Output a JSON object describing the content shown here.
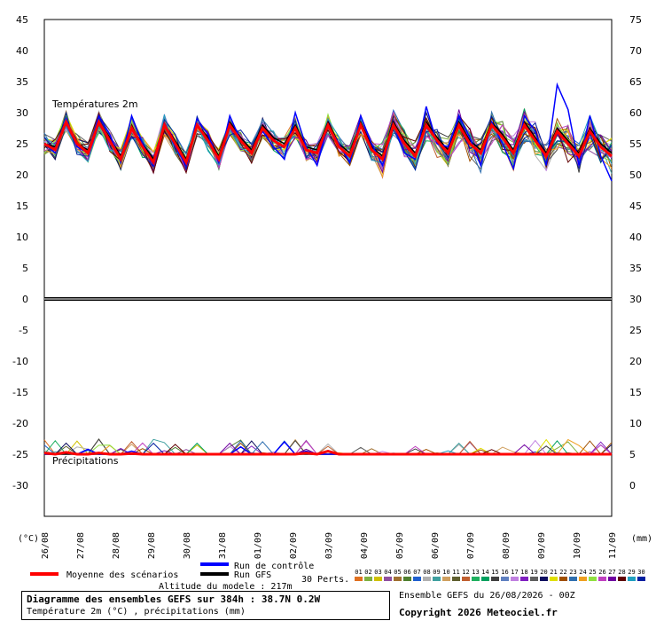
{
  "chart_data": {
    "type": "line",
    "panels": [
      {
        "title": "Températures 2m",
        "ylabel_left": "(°C)",
        "ylim_left": [
          0,
          45
        ],
        "ylim_right": [
          30,
          75
        ]
      },
      {
        "title": "Précipitations",
        "ylabel_right": "(mm)",
        "ylim_left": [
          -35,
          0
        ],
        "ylim_right": [
          -5,
          30
        ]
      }
    ],
    "left_ticks": [
      "45",
      "40",
      "35",
      "30",
      "25",
      "20",
      "15",
      "10",
      "5",
      "0",
      "-5",
      "-10",
      "-15",
      "-20",
      "-25",
      "-30"
    ],
    "right_ticks": [
      "75",
      "70",
      "65",
      "60",
      "55",
      "50",
      "45",
      "40",
      "35",
      "30",
      "25",
      "20",
      "15",
      "10",
      "5",
      "0"
    ],
    "x_labels": [
      "26/08",
      "27/08",
      "28/08",
      "29/08",
      "30/08",
      "31/08",
      "01/09",
      "02/09",
      "03/09",
      "04/09",
      "05/09",
      "06/09",
      "07/09",
      "08/09",
      "09/09",
      "10/09",
      "11/09"
    ],
    "x_unit_left": "(°C)",
    "x_unit_right": "(mm)",
    "series": [
      {
        "name": "Moyenne des scénarios",
        "color": "#ff0000",
        "temp": [
          25.0,
          24.0,
          28.5,
          25.0,
          23.5,
          28.5,
          25.5,
          22.5,
          27.5,
          24.5,
          22.0,
          28.0,
          25.0,
          22.0,
          28.0,
          25.5,
          22.5,
          28.0,
          25.5,
          23.5,
          27.5,
          25.5,
          24.5,
          27.5,
          24.0,
          23.5,
          28.0,
          24.5,
          23.0,
          28.0,
          24.0,
          22.5,
          28.0,
          25.0,
          23.0,
          28.0,
          25.5,
          23.5,
          28.0,
          25.0,
          23.5,
          28.0,
          26.0,
          23.5,
          28.0,
          25.5,
          23.0,
          27.0,
          25.0,
          23.0,
          27.0,
          24.5,
          23.0
        ],
        "precip": [
          0.2,
          0.0,
          0.3,
          0.0,
          0.0,
          0.2,
          0.0,
          0.0,
          0.1,
          0.0,
          0.0,
          0.0,
          0.0,
          0.0,
          0.0,
          0.0,
          0.0,
          0.0,
          0.0,
          0.0,
          0.0,
          0.0,
          0.0,
          0.0,
          0.2,
          0.0,
          0.5,
          0.0,
          0.0,
          0.0,
          0.0,
          0.0,
          0.0,
          0.0,
          0.0,
          0.0,
          0.0,
          0.0,
          0.0,
          0.0,
          0.0,
          0.0,
          0.0,
          0.0,
          0.0,
          0.0,
          0.0,
          0.0,
          0.0,
          0.0,
          0.0,
          0.0,
          0.0
        ]
      },
      {
        "name": "Run de contrôle",
        "color": "#0000ff",
        "temp": [
          25.0,
          23.5,
          29.0,
          24.5,
          23.5,
          29.5,
          26.5,
          22.0,
          29.5,
          25.0,
          21.5,
          28.0,
          24.5,
          21.5,
          29.0,
          26.5,
          22.0,
          29.5,
          25.5,
          23.5,
          27.0,
          24.5,
          22.5,
          30.0,
          24.5,
          21.5,
          28.0,
          25.0,
          22.0,
          29.5,
          25.0,
          21.5,
          28.0,
          23.5,
          22.5,
          31.0,
          25.0,
          24.5,
          29.5,
          26.0,
          21.5,
          28.5,
          25.0,
          21.0,
          29.5,
          27.0,
          21.5,
          34.5,
          30.5,
          21.5,
          29.5,
          23.0,
          19.0
        ],
        "precip": [
          0.0,
          0.0,
          0.2,
          0.0,
          0.8,
          0.0,
          0.0,
          0.0,
          0.5,
          0.0,
          0.0,
          0.0,
          0.0,
          0.0,
          0.0,
          0.0,
          0.0,
          0.0,
          1.2,
          0.0,
          0.0,
          0.0,
          2.0,
          0.0,
          0.5,
          0.0,
          0.0,
          0.0,
          0.0,
          0.0,
          0.0,
          0.0,
          0.0,
          0.0,
          0.0,
          0.0,
          0.0,
          0.0,
          0.0,
          0.0,
          0.0,
          0.0,
          0.0,
          0.0,
          0.0,
          0.0,
          0.0,
          0.0,
          0.0,
          0.0,
          0.0,
          0.0,
          0.0
        ]
      },
      {
        "name": "Run GFS",
        "color": "#000000",
        "temp": [
          25.0,
          24.5,
          28.5,
          25.0,
          24.0,
          28.5,
          26.0,
          23.0,
          27.5,
          25.0,
          22.5,
          28.0,
          25.5,
          22.5,
          28.0,
          26.0,
          23.0,
          28.5,
          26.0,
          24.0,
          28.0,
          26.0,
          25.0,
          28.0,
          24.5,
          24.0,
          28.5,
          25.0,
          23.5,
          28.5,
          24.5,
          23.0,
          28.5,
          25.5,
          23.5,
          28.5,
          26.0,
          24.0,
          28.5,
          25.5,
          24.0,
          28.5,
          26.5,
          24.0,
          28.5,
          26.0,
          23.5,
          27.5,
          25.5,
          23.5,
          27.5,
          25.0,
          23.5
        ],
        "precip": [
          0.0,
          0.0,
          0.0,
          0.0,
          0.0,
          0.0,
          0.0,
          0.0,
          0.0,
          0.0,
          0.0,
          0.0,
          0.0,
          0.0,
          0.0,
          0.0,
          0.0,
          0.0,
          0.0,
          0.0,
          0.0,
          0.0,
          0.0,
          0.0,
          0.0,
          0.0,
          0.0,
          0.0,
          0.0,
          0.0,
          0.0,
          0.0,
          0.0,
          0.0,
          0.0,
          0.0,
          0.0,
          0.0,
          0.0,
          0.0,
          0.0,
          0.0,
          0.0,
          0.0,
          0.0,
          0.0,
          0.0,
          0.0,
          0.0,
          0.0,
          0.0,
          0.0,
          0.0
        ]
      }
    ],
    "perturbations": {
      "label": "30 Perts.",
      "numbers": [
        "01",
        "02",
        "03",
        "04",
        "05",
        "06",
        "07",
        "08",
        "09",
        "10",
        "11",
        "12",
        "13",
        "14",
        "15",
        "16",
        "17",
        "18",
        "19",
        "20",
        "21",
        "22",
        "23",
        "24",
        "25",
        "26",
        "27",
        "28",
        "29",
        "30"
      ],
      "colors": [
        "#e07020",
        "#80b040",
        "#d0c000",
        "#9050a0",
        "#a07030",
        "#508030",
        "#2060d0",
        "#b0b0b0",
        "#40a0a0",
        "#d0a060",
        "#606030",
        "#c06030",
        "#20b060",
        "#00a060",
        "#404040",
        "#6080c0",
        "#c080e0",
        "#8020c0",
        "#606060",
        "#101060",
        "#e0e000",
        "#a05000",
        "#3070b0",
        "#f0a020",
        "#90e040",
        "#c040c0",
        "#7000a0",
        "#600000",
        "#20a0c0",
        "#0020a0"
      ]
    },
    "grid": true,
    "legend_position": "bottom-left"
  },
  "legend": {
    "mean": "Moyenne des scénarios",
    "control": "Run de contrôle",
    "gfs": "Run GFS",
    "altitude": "Altitude du modele : 217m"
  },
  "footer": {
    "title": "Diagramme des ensembles GEFS sur 384h : 38.7N 0.2W",
    "subtitle": "Température 2m (°C) , précipitations (mm)",
    "run": "Ensemble GEFS du 26/08/2026 - 00Z",
    "copyright": "Copyright 2026 Meteociel.fr"
  }
}
